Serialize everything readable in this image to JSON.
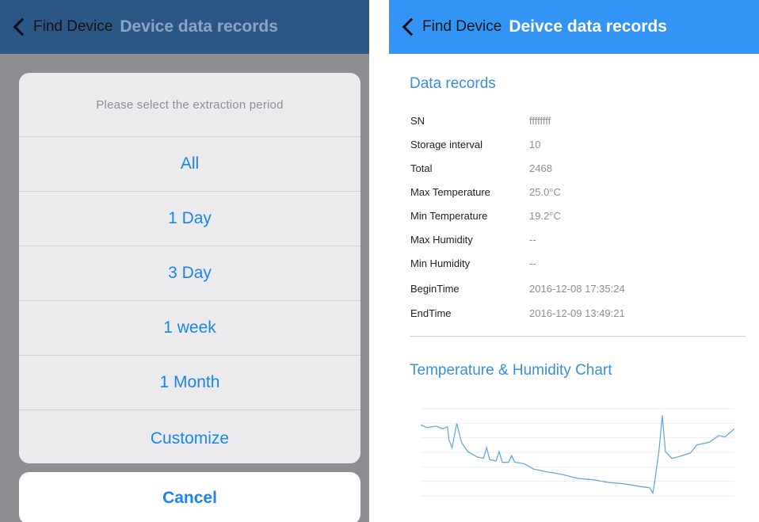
{
  "left": {
    "nav": {
      "back_label": "Find Device",
      "title": "Device data records"
    },
    "sheet": {
      "header": "Please select the extraction period",
      "options": [
        "All",
        "1 Day",
        "3 Day",
        "1 week",
        "1 Month",
        "Customize"
      ],
      "cancel": "Cancel"
    }
  },
  "right": {
    "nav": {
      "back_label": "Find Device",
      "title": "Deivce data records"
    },
    "records_title": "Data records",
    "records": [
      {
        "label": "SN",
        "value": "ffffffff"
      },
      {
        "label": "Storage interval",
        "value": "10"
      },
      {
        "label": "Total",
        "value": "2468"
      },
      {
        "label": "Max Temperature",
        "value": "25.0°C"
      },
      {
        "label": "Min Temperature",
        "value": "19.2°C"
      },
      {
        "label": "Max Humidity",
        "value": "--"
      },
      {
        "label": "Min Humidity",
        "value": "--"
      },
      {
        "label": "BeginTime",
        "value": "2016-12-08 17:35:24"
      },
      {
        "label": "EndTime",
        "value": "2016-12-09 13:49:21"
      }
    ],
    "chart_title": "Temperature & Humidity Chart"
  },
  "colors": {
    "left_nav": "#2b5784",
    "right_nav": "#3294f5",
    "option_blue": "#1b84ec",
    "section_blue": "#3a8fd9",
    "line": "#6aa7dc"
  },
  "icons": {
    "back": "chevron-left-icon"
  },
  "chart_data": {
    "type": "line",
    "title": "Temperature & Humidity Chart",
    "xlabel": "",
    "ylabel": "",
    "x_range": [
      "2016-12-08 17:35:24",
      "2016-12-09 13:49:21"
    ],
    "ylim": [
      19,
      25.5
    ],
    "grid": true,
    "series": [
      {
        "points": [
          [
            0.0,
            24.3
          ],
          [
            0.02,
            24.1
          ],
          [
            0.05,
            24.2
          ],
          [
            0.07,
            24.0
          ],
          [
            0.085,
            24.15
          ],
          [
            0.09,
            23.2
          ],
          [
            0.1,
            22.6
          ],
          [
            0.115,
            24.4
          ],
          [
            0.13,
            23.0
          ],
          [
            0.15,
            22.3
          ],
          [
            0.18,
            21.9
          ],
          [
            0.2,
            21.8
          ],
          [
            0.21,
            22.6
          ],
          [
            0.22,
            21.7
          ],
          [
            0.24,
            21.6
          ],
          [
            0.25,
            22.3
          ],
          [
            0.26,
            21.5
          ],
          [
            0.28,
            21.5
          ],
          [
            0.29,
            22.0
          ],
          [
            0.3,
            21.5
          ],
          [
            0.33,
            21.4
          ],
          [
            0.36,
            21.0
          ],
          [
            0.4,
            20.8
          ],
          [
            0.45,
            20.6
          ],
          [
            0.5,
            20.3
          ],
          [
            0.55,
            20.2
          ],
          [
            0.6,
            20.0
          ],
          [
            0.65,
            19.9
          ],
          [
            0.7,
            19.7
          ],
          [
            0.73,
            19.6
          ],
          [
            0.74,
            19.2
          ],
          [
            0.745,
            19.9
          ],
          [
            0.76,
            22.5
          ],
          [
            0.77,
            25.0
          ],
          [
            0.78,
            22.3
          ],
          [
            0.8,
            21.8
          ],
          [
            0.82,
            21.9
          ],
          [
            0.86,
            22.2
          ],
          [
            0.88,
            22.8
          ],
          [
            0.92,
            23.0
          ],
          [
            0.95,
            23.5
          ],
          [
            0.97,
            23.4
          ],
          [
            1.0,
            24.0
          ]
        ]
      }
    ]
  }
}
